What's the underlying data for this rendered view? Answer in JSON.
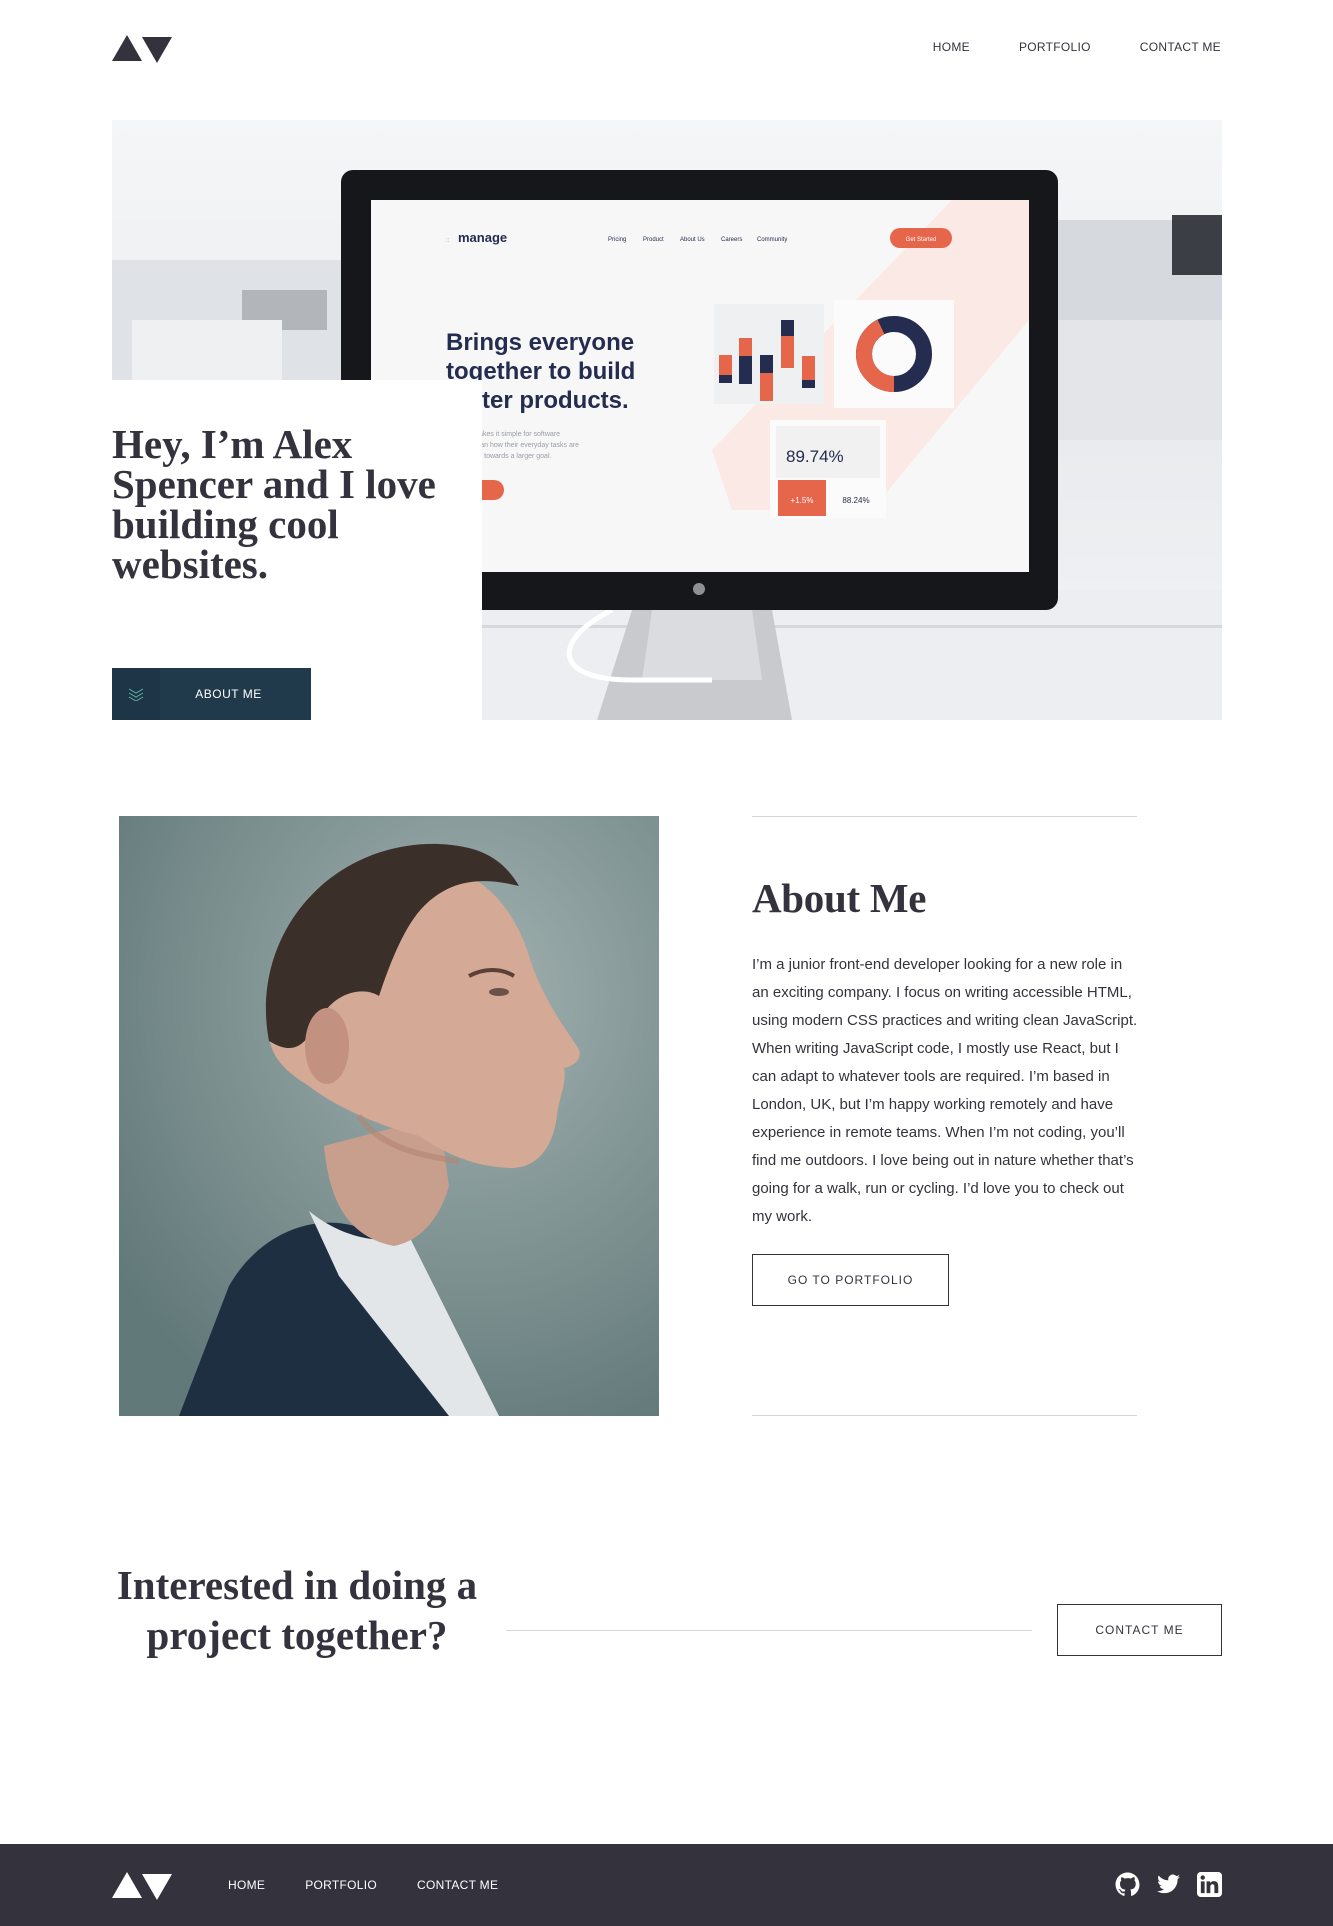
{
  "brand": {
    "logo_name": "av-logo",
    "colors": {
      "dark": "#33323d",
      "navy": "#203a4c",
      "accent": "#e6664b",
      "light": "#f4f4f6"
    }
  },
  "nav": {
    "items": [
      "HOME",
      "PORTFOLIO",
      "CONTACT ME"
    ]
  },
  "hero": {
    "title": "Hey, I’m Alex Spencer and I love building cool websites.",
    "button_label": "ABOUT ME",
    "mockup": {
      "brand": "manage",
      "nav": [
        "Pricing",
        "Product",
        "About Us",
        "Careers",
        "Community"
      ],
      "cta": "Get Started",
      "headline": [
        "Brings everyone",
        "together to build",
        "better products."
      ],
      "body": [
        "Manage makes it simple for software",
        "teams to plan how their everyday tasks are",
        "contributing towards a larger goal."
      ],
      "stat_main": "89.74%",
      "stat_delta": "+1.5%",
      "stat_secondary": "88.24%"
    }
  },
  "about": {
    "title": "About Me",
    "body": "I’m a junior front-end developer looking for a new role in an exciting company. I focus on writing accessible HTML, using modern CSS practices and writing clean JavaScript. When writing JavaScript code, I mostly use React, but I can adapt to whatever tools are required. I’m based in London, UK, but I’m happy working remotely and have experience in remote teams. When I’m not coding, you’ll find me outdoors. I love being out in nature whether that’s going for a walk, run or cycling. I’d love you to check out my work.",
    "button_label": "GO TO PORTFOLIO"
  },
  "cta": {
    "title": "Interested in doing a project together?",
    "button_label": "CONTACT ME"
  },
  "footer": {
    "nav": [
      "HOME",
      "PORTFOLIO",
      "CONTACT ME"
    ],
    "social": [
      "github-icon",
      "twitter-icon",
      "linkedin-icon"
    ]
  }
}
